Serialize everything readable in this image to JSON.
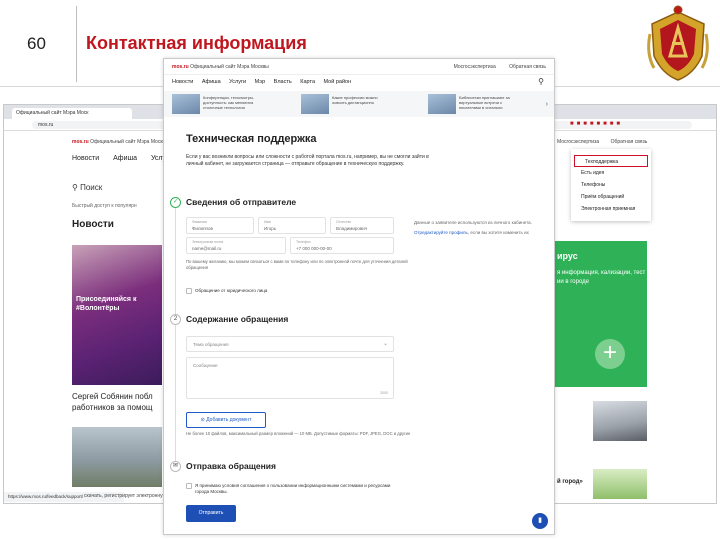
{
  "slide": {
    "number": "60",
    "title": "Контактная информация"
  },
  "background_page": {
    "tab_title": "Официальный сайт Мэра Моск",
    "url": "mos.ru",
    "logo": "mos.ru",
    "logo_sub": "Официальный сайт Мэра Москв",
    "nav": [
      "Новости",
      "Афиша",
      "Услуги"
    ],
    "right_links": [
      "Мосгосэкспертиза",
      "Обратная связь"
    ],
    "dropdown": [
      "Техподдержка",
      "Есть идея",
      "Телефоны",
      "Приём обращений",
      "Электронная приемная"
    ],
    "search_label": "Поиск",
    "quick_access": "Быстрый доступ к популярн",
    "news_heading": "Новости",
    "photo_text": "Присоединяйся к #Волонтёры",
    "news_caption": "Сергей Собянин побл работников за помощ",
    "green_title": "ирус",
    "green_text": "я информация, кализации, тест ии в городе",
    "gorod_text": "й город»",
    "status_url": "https://www.mos.ru/feedback/support/",
    "bottom_link": "скачать, регистрирует электронную"
  },
  "overlay": {
    "logo": "mos.ru",
    "logo_sub": "Официальный сайт Мэра Москвы",
    "top_links": [
      "Мосгосэкспертиза",
      "Обратная связь"
    ],
    "nav": [
      "Новости",
      "Афиша",
      "Услуги",
      "Мэр",
      "Власть",
      "Карта",
      "Мой район"
    ],
    "cards": [
      "Конференции, техосмотры, доступность: как меняются столичные технологии",
      "Какие профессии можно освоить дистанционно",
      "Библиотеки приглашают за виртуальные встречи с писателями в читальни"
    ],
    "heading": "Техническая поддержка",
    "intro": "Если у вас возникли вопросы или сложности с работой портала mos.ru, например, вы не смогли зайти в личный кабинет, не загружается страница — отправьте обращение в техническую поддержку.",
    "step1": {
      "title": "Сведения об отправителе",
      "fields": [
        {
          "label": "Фамилия",
          "value": "Филиппов"
        },
        {
          "label": "Имя",
          "value": "Игорь"
        },
        {
          "label": "Отчество",
          "value": "Владимирович"
        },
        {
          "label": "Электронная почта",
          "value": "name@mail.ru"
        },
        {
          "label": "Телефон",
          "value": "+7 000 000-00-00"
        }
      ],
      "side_note": "Данные о заявителе используются из личного кабинета.",
      "side_link": "Отредактируйте профиль",
      "side_link_rest": ", если вы хотите изменить их",
      "note": "По вашему желанию, мы можем связаться с вами по телефону или по электронной почте для уточнения деталей обращения",
      "legal_check": "Обращение от юридического лица"
    },
    "step2": {
      "title": "Содержание обращения",
      "subject_placeholder": "Тема обращения",
      "message_placeholder": "Сообщение",
      "counter": "2000",
      "attach": "Добавить документ",
      "attach_note": "Не более 10 файлов, максимальный размер вложений — 10 МБ. Допустимые форматы: PDF, JPEG, DOC и другие"
    },
    "step3": {
      "title": "Отправка обращения",
      "agree": "Я принимаю условия соглашения о пользовании информационными системами и ресурсами города Москвы.",
      "submit": "Отправить"
    }
  }
}
